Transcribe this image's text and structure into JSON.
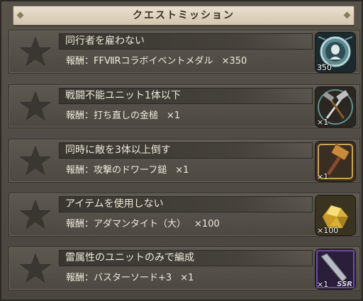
{
  "header": {
    "title": "クエストミッション"
  },
  "missions": [
    {
      "title": "同行者を雇わない",
      "reward_label": "報酬：",
      "reward_name": "FFⅦRコラボイベントメダル",
      "reward_count": "×350",
      "item_qty": "350",
      "item_icon": "medal-icon"
    },
    {
      "title": "戦闘不能ユニット1体以下",
      "reward_label": "報酬：",
      "reward_name": "打ち直しの金槌",
      "reward_count": "×1",
      "item_qty": "×1",
      "item_icon": "hammer-icon"
    },
    {
      "title": "同時に敵を3体以上倒す",
      "reward_label": "報酬：",
      "reward_name": "攻撃のドワーフ鎚",
      "reward_count": "×1",
      "item_qty": "×1",
      "item_icon": "dwarf-hammer-icon"
    },
    {
      "title": "アイテムを使用しない",
      "reward_label": "報酬：",
      "reward_name": "アダマンタイト（大）",
      "reward_count": "×100",
      "item_qty": "×100",
      "item_icon": "adamantite-icon"
    },
    {
      "title": "雷属性のユニットのみで編成",
      "reward_label": "報酬：",
      "reward_name": "バスターソード+3",
      "reward_count": "×1",
      "item_qty": "×1",
      "item_rarity": "SSR",
      "item_icon": "buster-sword-icon"
    }
  ],
  "colors": {
    "panel": "#4b4740",
    "header_bg": "#e0d6c1",
    "text": "#f0eadc",
    "star": "#3a3631"
  }
}
